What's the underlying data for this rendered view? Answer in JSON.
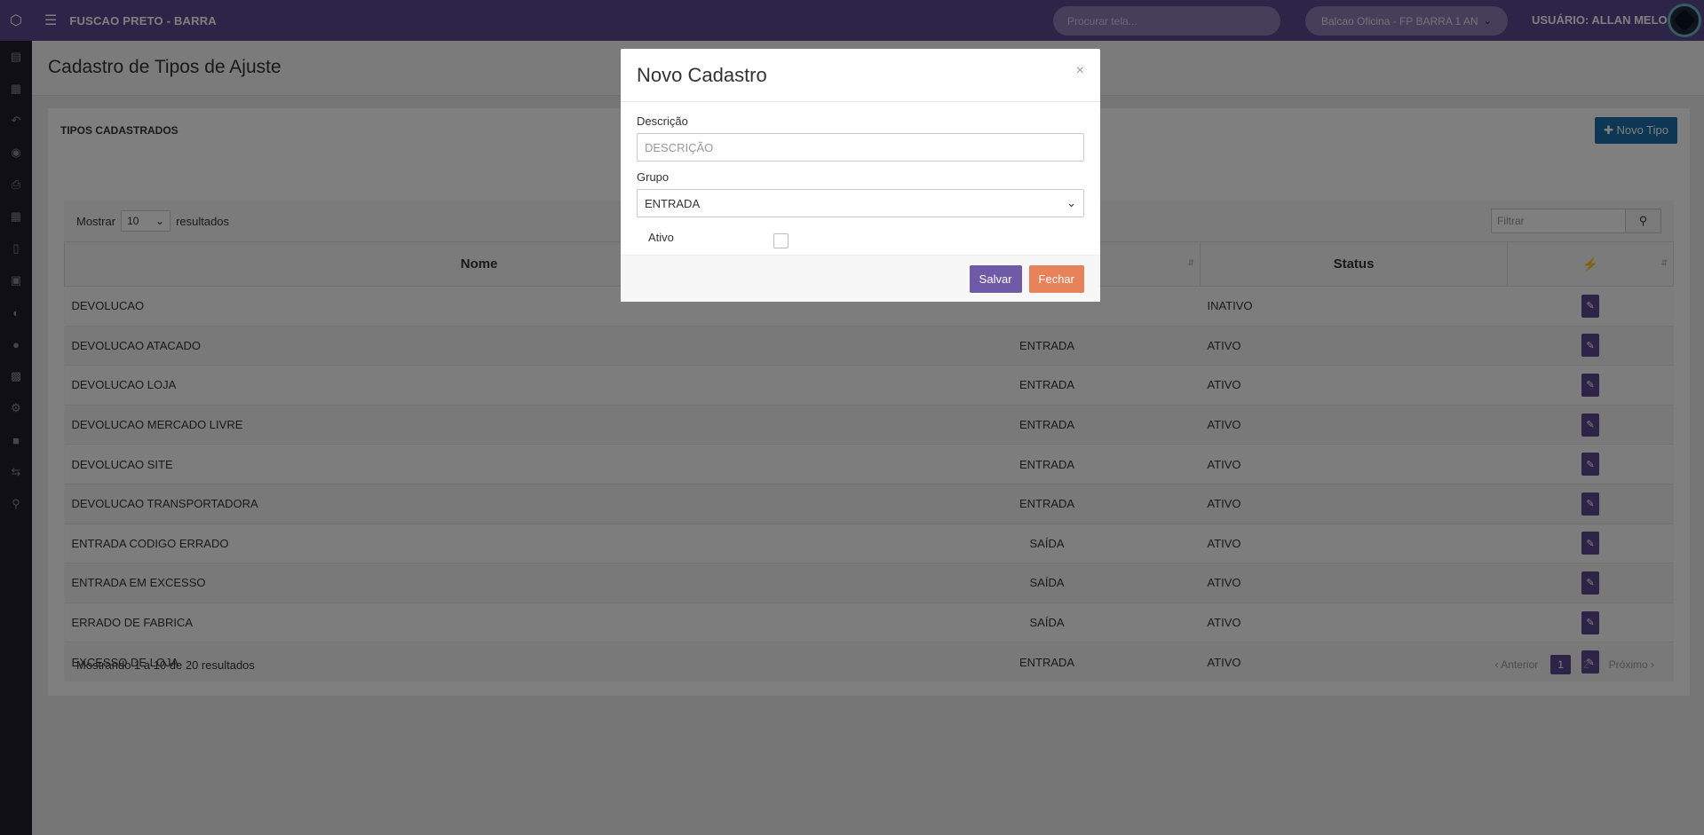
{
  "topbar": {
    "app_title": "FUSCAO PRETO - BARRA",
    "search_placeholder": "Procurar tela...",
    "store_select": "Balcao Oficina - FP BARRA 1 AN",
    "user_label": "USUÁRIO: ALLAN MELO"
  },
  "page": {
    "title": "Cadastro de Tipos de Ajuste",
    "panel_title": "TIPOS CADASTRADOS",
    "new_button": "Novo Tipo"
  },
  "table": {
    "length_prefix": "Mostrar",
    "length_value": "10",
    "length_suffix": "resultados",
    "filter_placeholder": "Filtrar",
    "headers": [
      "Nome",
      "",
      "Status",
      ""
    ],
    "rows": [
      {
        "nome": "DEVOLUCAO",
        "grupo": "",
        "status": "INATIVO"
      },
      {
        "nome": "DEVOLUCAO ATACADO",
        "grupo": "ENTRADA",
        "status": "ATIVO"
      },
      {
        "nome": "DEVOLUCAO LOJA",
        "grupo": "ENTRADA",
        "status": "ATIVO"
      },
      {
        "nome": "DEVOLUCAO MERCADO LIVRE",
        "grupo": "ENTRADA",
        "status": "ATIVO"
      },
      {
        "nome": "DEVOLUCAO SITE",
        "grupo": "ENTRADA",
        "status": "ATIVO"
      },
      {
        "nome": "DEVOLUCAO TRANSPORTADORA",
        "grupo": "ENTRADA",
        "status": "ATIVO"
      },
      {
        "nome": "ENTRADA CODIGO ERRADO",
        "grupo": "SAÍDA",
        "status": "ATIVO"
      },
      {
        "nome": "ENTRADA EM EXCESSO",
        "grupo": "SAÍDA",
        "status": "ATIVO"
      },
      {
        "nome": "ERRADO DE FABRICA",
        "grupo": "SAÍDA",
        "status": "ATIVO"
      },
      {
        "nome": "EXCESSO DE LOJA",
        "grupo": "ENTRADA",
        "status": "ATIVO"
      }
    ],
    "info": "Mostrando 1 a 10 de 20 resultados",
    "pager": {
      "prev": "Anterior",
      "pages": [
        "1",
        "2"
      ],
      "next": "Próximo"
    }
  },
  "modal": {
    "title": "Novo Cadastro",
    "close": "×",
    "desc_label": "Descrição",
    "desc_placeholder": "DESCRIÇÃO",
    "group_label": "Grupo",
    "group_value": "ENTRADA",
    "active_label": "Ativo",
    "save": "Salvar",
    "close_button": "Fechar"
  },
  "colors": {
    "topbar": "#5b4a8f",
    "sidebar": "#1e1e2a",
    "accent_blue": "#1a6ea8",
    "salvar": "#6f5aa8",
    "fechar": "#e8825a"
  }
}
